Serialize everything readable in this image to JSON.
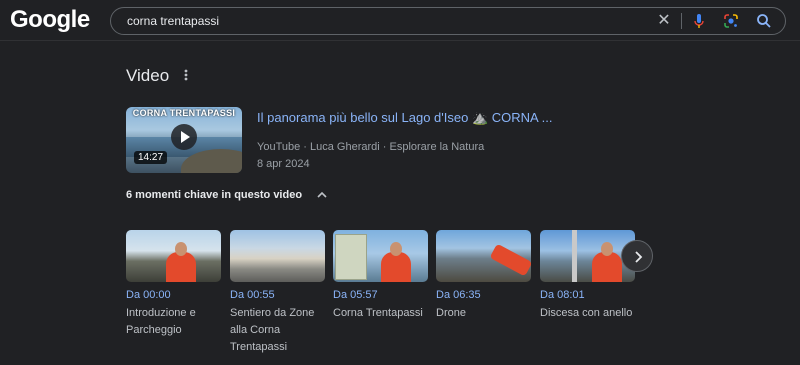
{
  "header": {
    "logo": "Google",
    "search_value": "corna trentapassi"
  },
  "video_section": {
    "title": "Video",
    "result": {
      "thumb_title": "CORNA TRENTAPASSI",
      "duration": "14:27",
      "title": "Il panorama più bello sul Lago d'Iseo ⛰️ CORNA ...",
      "meta": "YouTube · Luca Gherardi · Esplorare la Natura",
      "date": "8 apr 2024"
    },
    "moments_header": "6 momenti chiave in questo video",
    "moments": [
      {
        "time": "Da 00:00",
        "label": "Introduzione e Parcheggio"
      },
      {
        "time": "Da 00:55",
        "label": "Sentiero da Zone alla Corna Trentapassi"
      },
      {
        "time": "Da 05:57",
        "label": "Corna Trentapassi"
      },
      {
        "time": "Da 06:35",
        "label": "Drone"
      },
      {
        "time": "Da 08:01",
        "label": "Discesa con anello"
      }
    ]
  },
  "colors": {
    "background": "#202124",
    "link": "#8ab4f8",
    "secondary_text": "#9aa0a6"
  }
}
